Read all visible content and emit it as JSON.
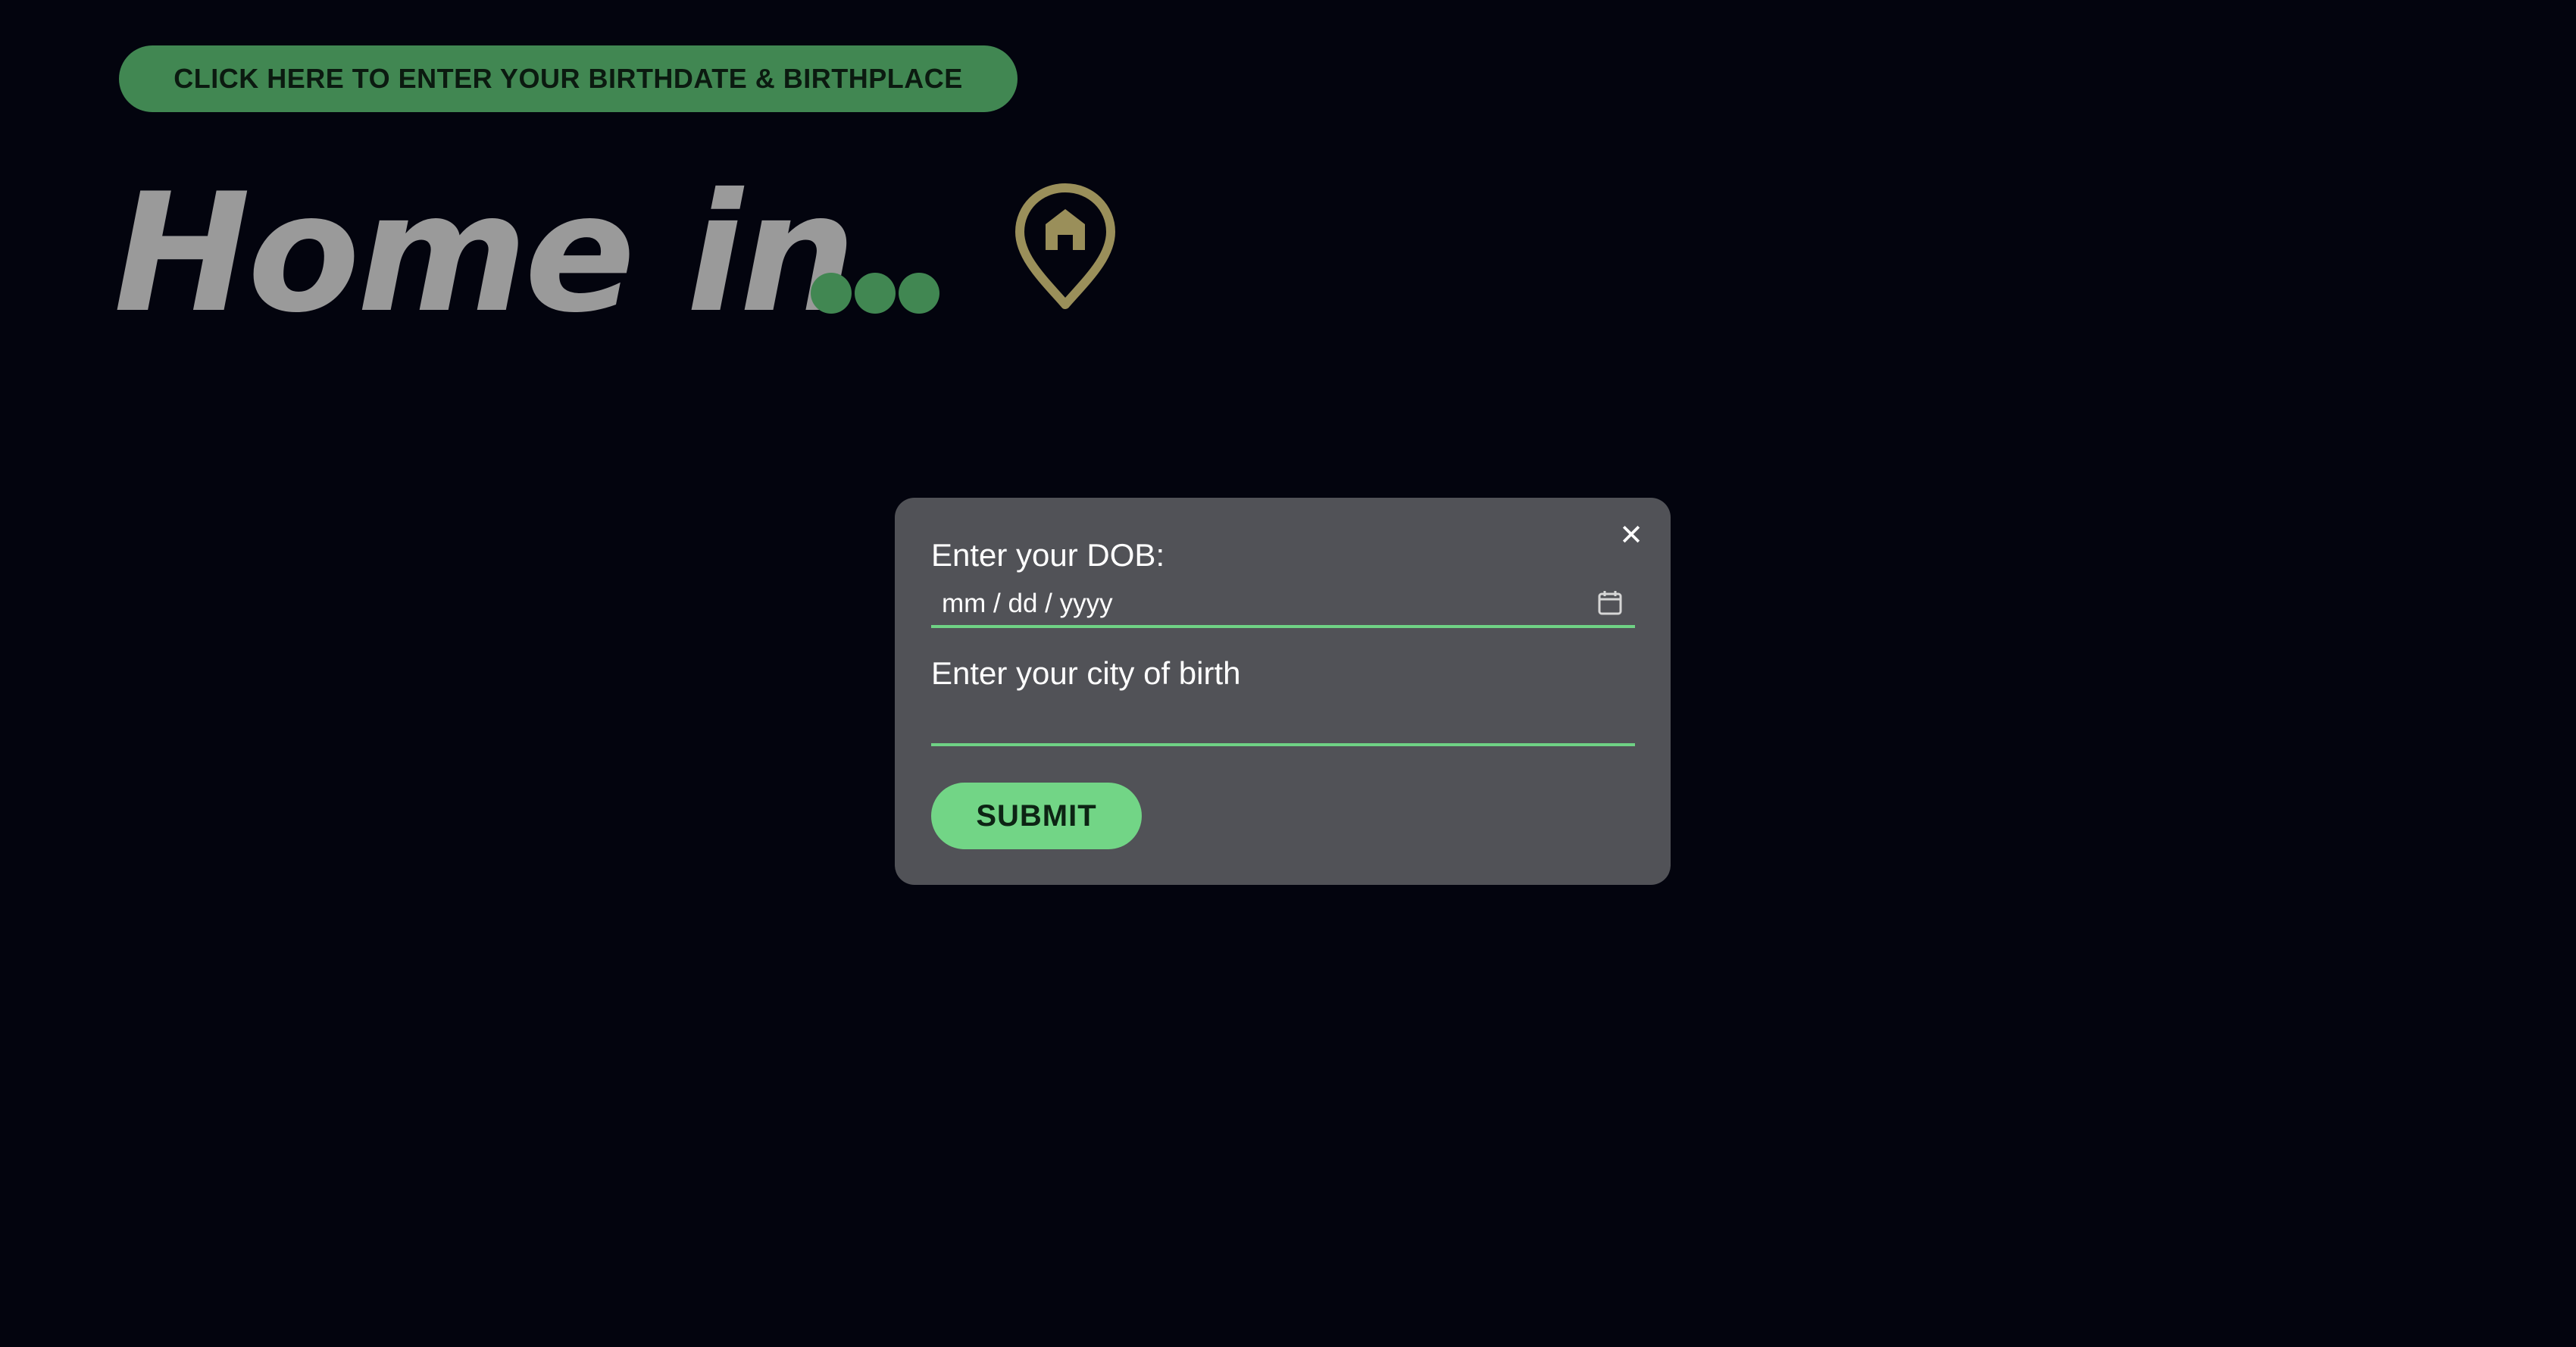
{
  "header": {
    "open_form_label": "CLICK HERE TO ENTER YOUR BIRTHDATE & BIRTHPLACE"
  },
  "hero": {
    "title": "Home in",
    "suffix_icon": "ellipsis-dots-icon",
    "location_icon": "home-location-pin-icon"
  },
  "modal": {
    "close_label": "✕",
    "close_icon": "close-icon",
    "dob_label": "Enter your DOB:",
    "dob_placeholder": "mm / dd / yyyy",
    "dob_value": "",
    "calendar_icon": "calendar-icon",
    "city_label": "Enter your city of birth",
    "city_value": "",
    "submit_label": "SUBMIT"
  },
  "colors": {
    "background": "#03040e",
    "accent_green": "#418752",
    "submit_green": "#72d586",
    "input_underline": "#6fd285",
    "modal_bg": "#515257",
    "pin_olive": "#9a8f5a",
    "title_gray": "#9a9a9a"
  }
}
